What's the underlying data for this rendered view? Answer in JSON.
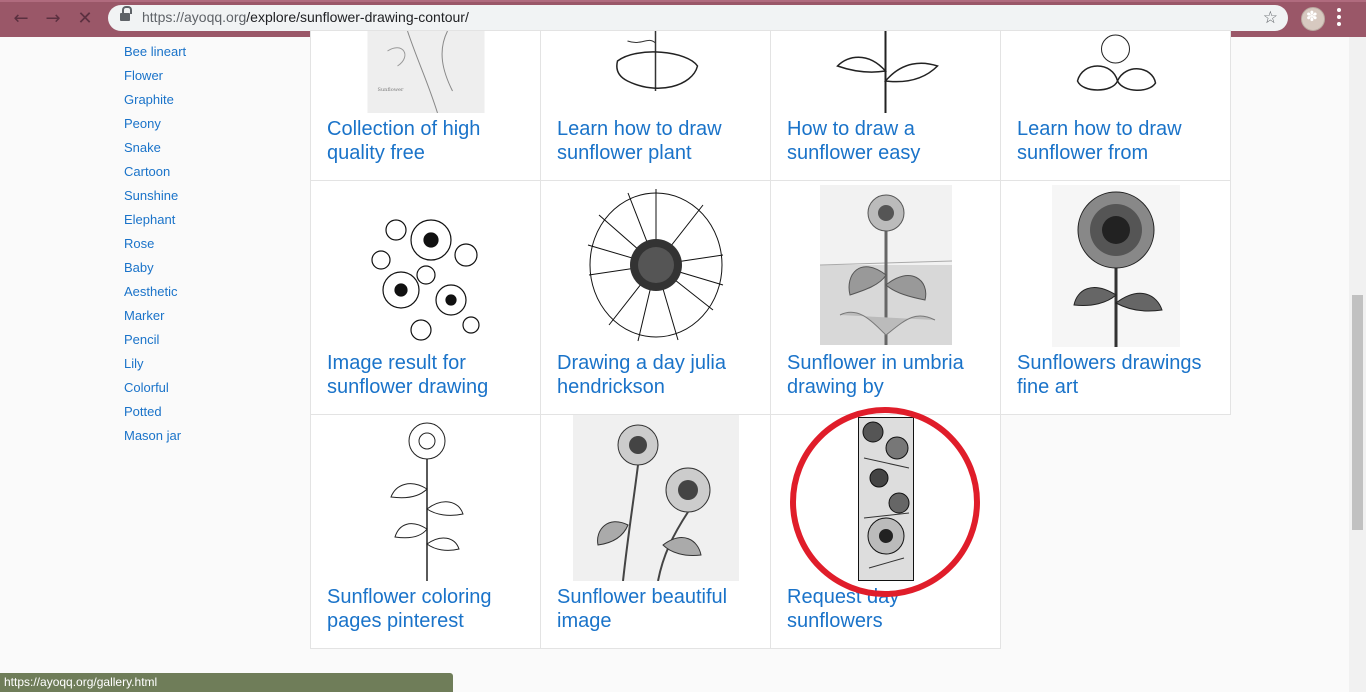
{
  "browser": {
    "url_host": "https://ayoqq.org",
    "url_path": "/explore/sunflower-drawing-contour/",
    "back_icon": "←",
    "forward_icon": "→",
    "stop_icon": "✕",
    "bookmark_icon": "☆",
    "status_url": "https://ayoqq.org/gallery.html"
  },
  "sidebar": {
    "links": [
      "Bee lineart",
      "Flower",
      "Graphite",
      "Peony",
      "Snake",
      "Cartoon",
      "Sunshine",
      "Elephant",
      "Rose",
      "Baby",
      "Aesthetic",
      "Marker",
      "Pencil",
      "Lily",
      "Colorful",
      "Potted",
      "Mason jar"
    ]
  },
  "gallery": {
    "cards": [
      {
        "title": "Collection of high quality free"
      },
      {
        "title": "Learn how to draw sunflower plant"
      },
      {
        "title": "How to draw a sunflower easy"
      },
      {
        "title": "Learn how to draw sunflower from"
      },
      {
        "title": "Image result for sunflower drawing"
      },
      {
        "title": "Drawing a day julia hendrickson"
      },
      {
        "title": "Sunflower in umbria drawing by"
      },
      {
        "title": "Sunflowers drawings fine art"
      },
      {
        "title": "Sunflower coloring pages pinterest"
      },
      {
        "title": "Sunflower beautiful image"
      },
      {
        "title": "Request day sunflowers"
      }
    ]
  },
  "colors": {
    "chrome": "#9a5768",
    "link": "#1a73c9",
    "highlight_circle": "#e01d2a"
  }
}
